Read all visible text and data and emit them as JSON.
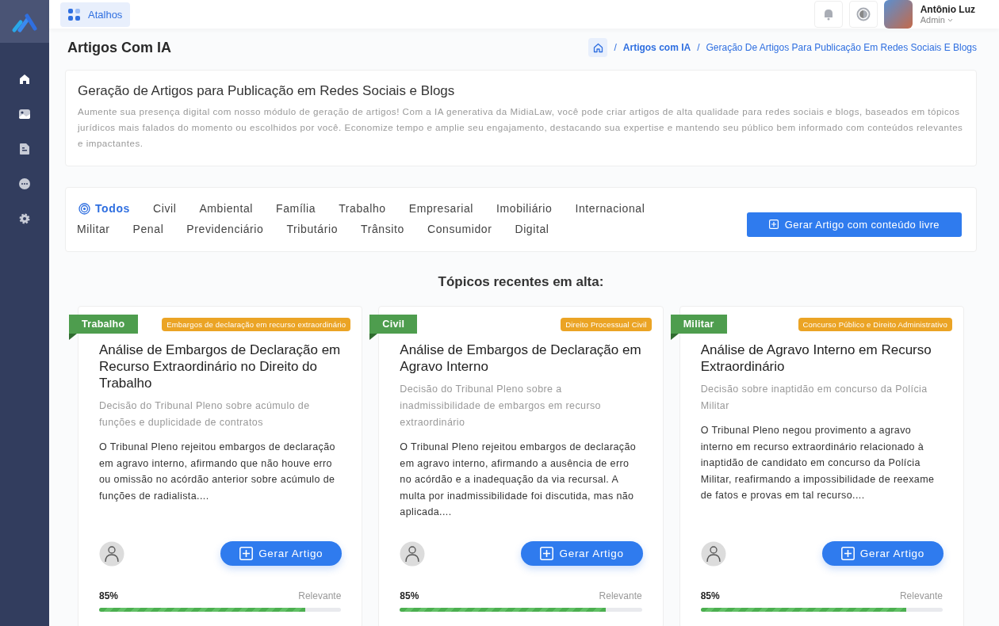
{
  "topbar": {
    "shortcuts": "Atalhos",
    "user": {
      "name": "Antônio Luz",
      "role": "Admin"
    }
  },
  "page": {
    "title": "Artigos Com IA",
    "separator": "/",
    "breadcrumb": [
      "Artigos com IA",
      "Geração De Artigos Para Publicação Em Redes Sociais E Blogs"
    ]
  },
  "intro": {
    "title": "Geração de Artigos para Publicação em Redes Sociais e Blogs",
    "text": "Aumente sua presença digital com nosso módulo de geração de artigos! Com a IA generativa da MidiaLaw, você pode criar artigos de alta qualidade para redes sociais e blogs, baseados em tópicos jurídicos mais falados do momento ou escolhidos por você. Economize tempo e amplie seu engajamento, destacando sua expertise e mantendo seu público bem informado com conteúdos relevantes e impactantes."
  },
  "filters": {
    "rows": [
      [
        {
          "label": "Todos",
          "selected": true
        },
        {
          "label": "Civil",
          "selected": false
        },
        {
          "label": "Ambiental",
          "selected": false
        },
        {
          "label": "Família",
          "selected": false
        },
        {
          "label": "Trabalho",
          "selected": false
        },
        {
          "label": "Empresarial",
          "selected": false
        },
        {
          "label": "Imobiliário",
          "selected": false
        },
        {
          "label": "Internacional",
          "selected": false
        }
      ],
      [
        {
          "label": "Militar",
          "selected": false
        },
        {
          "label": "Penal",
          "selected": false
        },
        {
          "label": "Previdenciário",
          "selected": false
        },
        {
          "label": "Tributário",
          "selected": false
        },
        {
          "label": "Trânsito",
          "selected": false
        },
        {
          "label": "Consumidor",
          "selected": false
        },
        {
          "label": "Digital",
          "selected": false
        }
      ]
    ],
    "free_button": "Gerar Artigo com conteúdo livre"
  },
  "topics_heading": "Tópicos recentes em alta:",
  "cards": [
    {
      "category": "Trabalho",
      "tag": "Embargos de declaração em recurso extraordinário",
      "title": "Análise de Embargos de Declaração em Recurso Extraordinário no Direito do Trabalho",
      "subtitle": "Decisão do Tribunal Pleno sobre acúmulo de funções e duplicidade de contratos",
      "body": "O Tribunal Pleno rejeitou embargos de declaração em agravo interno, afirmando que não houve erro ou omissão no acórdão anterior sobre acúmulo de funções de radialista....",
      "button": "Gerar Artigo",
      "percent": "85%",
      "relevance": "Relevante",
      "level": 0.85
    },
    {
      "category": "Civil",
      "tag": "Direito Processual Civil",
      "title": "Análise de Embargos de Declaração em Agravo Interno",
      "subtitle": "Decisão do Tribunal Pleno sobre a inadmissibilidade de embargos em recurso extraordinário",
      "body": "O Tribunal Pleno rejeitou embargos de declaração em agravo interno, afirmando a ausência de erro no acórdão e a inadequação da via recursal. A multa por inadmissibilidade foi discutida, mas não aplicada....",
      "button": "Gerar Artigo",
      "percent": "85%",
      "relevance": "Relevante",
      "level": 0.85
    },
    {
      "category": "Militar",
      "tag": "Concurso Público e Direito Administrativo",
      "title": "Análise de Agravo Interno em Recurso Extraordinário",
      "subtitle": "Decisão sobre inaptidão em concurso da Polícia Militar",
      "body": "O Tribunal Pleno negou provimento a agravo interno em recurso extraordinário relacionado à inaptidão de candidato em concurso da Polícia Militar, reafirmando a impossibilidade de reexame de fatos e provas em tal recurso....",
      "button": "Gerar Artigo",
      "percent": "85%",
      "relevance": "Relevante",
      "level": 0.85
    }
  ]
}
